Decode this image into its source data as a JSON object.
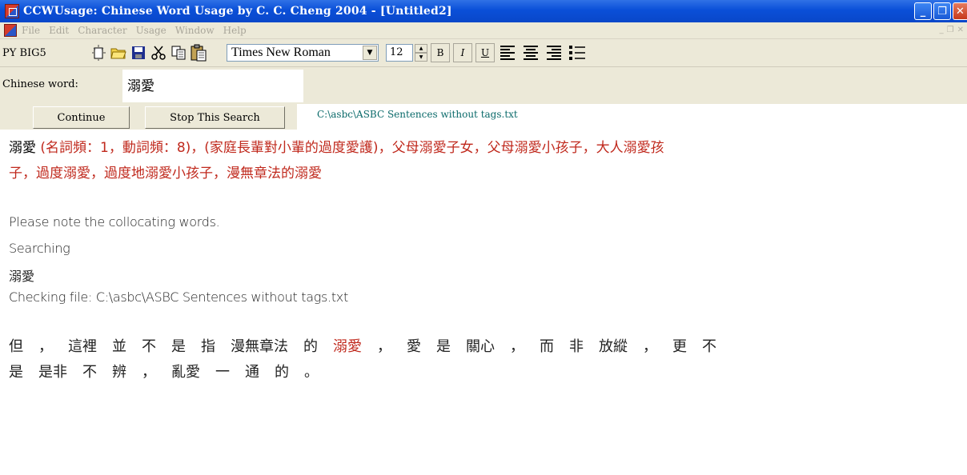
{
  "window": {
    "title": "CCWUsage: Chinese Word Usage  by C. C. Cheng 2004 - [Untitled2]",
    "controls": [
      "_",
      "❐",
      "✕"
    ]
  },
  "menu": [
    "File",
    "Edit",
    "Character",
    "Usage",
    "Window",
    "Help"
  ],
  "toolbar": {
    "py_label": "PY BIG5",
    "font_name": "Times New Roman",
    "font_size": "12",
    "bold": "B",
    "italic": "I",
    "underline": "U"
  },
  "word_row": {
    "label": "Chinese word:",
    "value": "溺愛"
  },
  "buttons": {
    "continue": "Continue",
    "stop": "Stop This Search",
    "path": "C:\\asbc\\ASBC Sentences without tags.txt"
  },
  "content": {
    "def_head": "溺愛",
    "def_line1": "(名詞頻：1，動詞頻：8)，(家庭長輩對小輩的過度愛護)，父母溺愛子女，父母溺愛小孩子，大人溺愛孩",
    "def_line2": "子，過度溺愛，過度地溺愛小孩子，漫無章法的溺愛",
    "note": "Please note the collocating words.",
    "searching": "Searching",
    "word": "溺愛",
    "checking": "Checking file: C:\\asbc\\ASBC Sentences without tags.txt",
    "sentence_line1": [
      "但",
      "，",
      "這裡",
      "並",
      "不",
      "是",
      "指",
      "漫無章法",
      "的",
      "溺愛",
      "，",
      "愛",
      "是",
      "關心",
      "，",
      "而",
      "非",
      "放縱",
      "，",
      "更",
      "不"
    ],
    "sentence_line2": [
      "是",
      "是非",
      "不",
      "辨",
      "，",
      "亂愛",
      "一",
      "通",
      "的",
      "。"
    ],
    "highlight_word": "溺愛"
  }
}
